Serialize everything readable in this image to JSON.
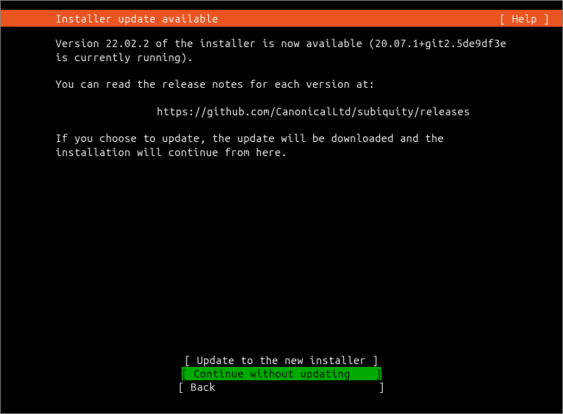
{
  "header": {
    "title": "Installer update available",
    "help": "[ Help ]"
  },
  "content": {
    "p1": "Version 22.02.2 of the installer is now available (20.07.1+git2.5de9df3e is currently running).",
    "p2": "You can read the release notes for each version at:",
    "url": "https://github.com/CanonicalLtd/subiquity/releases",
    "p3": "If you choose to update, the update will be downloaded and the installation will continue from here."
  },
  "buttons": {
    "update": "[ Update to the new installer ]",
    "continue": "[ Continue without updating    ]",
    "back": "[ Back                          ]"
  }
}
